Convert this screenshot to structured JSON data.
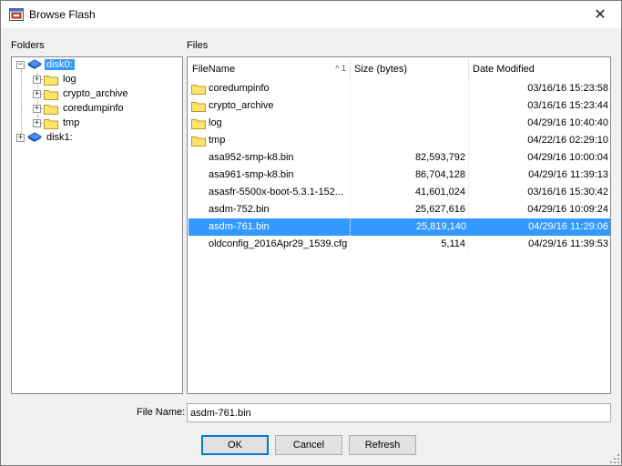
{
  "window": {
    "title": "Browse Flash",
    "icon": "flash-browser-icon"
  },
  "folders": {
    "label": "Folders",
    "tree": [
      {
        "label": "disk0:",
        "selected": true,
        "expanded": true,
        "icon": "disk-icon"
      },
      {
        "label": "log",
        "icon": "folder-icon"
      },
      {
        "label": "crypto_archive",
        "icon": "folder-icon"
      },
      {
        "label": "coredumpinfo",
        "icon": "folder-icon"
      },
      {
        "label": "tmp",
        "icon": "folder-icon"
      },
      {
        "label": "disk1:",
        "selected": false,
        "expanded": false,
        "icon": "disk-icon"
      }
    ]
  },
  "files": {
    "label": "Files",
    "columns": [
      "FileName",
      "Size (bytes)",
      "Date Modified"
    ],
    "sort_indicator": "^ 1",
    "rows": [
      {
        "name": "coredumpinfo",
        "size": "",
        "date": "03/16/16 15:23:58",
        "folder": true
      },
      {
        "name": "crypto_archive",
        "size": "",
        "date": "03/16/16 15:23:44",
        "folder": true
      },
      {
        "name": "log",
        "size": "",
        "date": "04/29/16 10:40:40",
        "folder": true
      },
      {
        "name": "tmp",
        "size": "",
        "date": "04/22/16 02:29:10",
        "folder": true
      },
      {
        "name": "asa952-smp-k8.bin",
        "size": "82,593,792",
        "date": "04/29/16 10:00:04",
        "folder": false
      },
      {
        "name": "asa961-smp-k8.bin",
        "size": "86,704,128",
        "date": "04/29/16 11:39:13",
        "folder": false
      },
      {
        "name": "asasfr-5500x-boot-5.3.1-152...",
        "size": "41,601,024",
        "date": "03/16/16 15:30:42",
        "folder": false
      },
      {
        "name": "asdm-752.bin",
        "size": "25,627,616",
        "date": "04/29/16 10:09:24",
        "folder": false
      },
      {
        "name": "asdm-761.bin",
        "size": "25,819,140",
        "date": "04/29/16 11:29:06",
        "folder": false,
        "selected": true
      },
      {
        "name": "oldconfig_2016Apr29_1539.cfg",
        "size": "5,114",
        "date": "04/29/16 11:39:53",
        "folder": false
      }
    ]
  },
  "file_name": {
    "label": "File Name:",
    "value": "asdm-761.bin"
  },
  "buttons": {
    "ok": "OK",
    "cancel": "Cancel",
    "refresh": "Refresh"
  },
  "colors": {
    "selection": "#3399ff",
    "folder_fill": "#ffe46b",
    "disk_fill": "#2e6fd8",
    "default_button_border": "#0078d7"
  }
}
